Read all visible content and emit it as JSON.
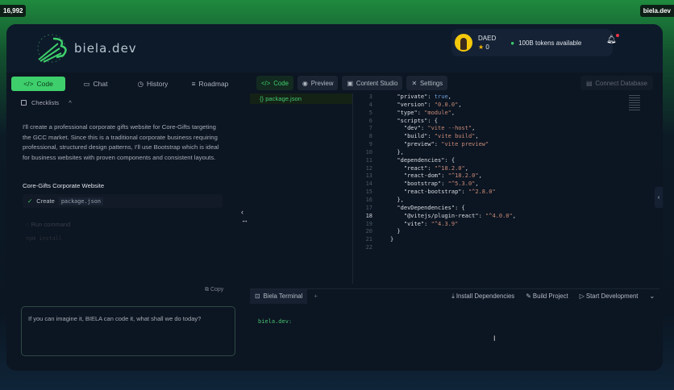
{
  "counter": "16,992",
  "badge": "biela.dev",
  "brand": {
    "name": "biela.dev",
    "accent": "#3ecf6c"
  },
  "user": {
    "name": "DAED",
    "stars": "0",
    "tokens": "100B tokens available"
  },
  "left": {
    "tabs": [
      {
        "label": "Code",
        "icon": "code-icon"
      },
      {
        "label": "Chat",
        "icon": "chat-icon"
      },
      {
        "label": "History",
        "icon": "clock-icon"
      },
      {
        "label": "Roadmap",
        "icon": "list-icon"
      }
    ],
    "checklists": "Checklists",
    "message": "I'll create a professional corporate gifts website for Core-Gifts targeting the GCC market. Since this is a traditional corporate business requiring professional, structured design patterns, I'll use Bootstrap which is ideal for business websites with proven components and consistent layouts.",
    "artifact_title": "Core-Gifts Corporate Website",
    "action_label": "Create",
    "action_file": "package.json",
    "faded_action": "Run command",
    "faded_cmd": "npm install",
    "copy": "Copy",
    "input_placeholder": "If you can imagine it, BIELA can code it, what shall we do today?"
  },
  "right": {
    "tabs": [
      {
        "label": "Code"
      },
      {
        "label": "Preview"
      },
      {
        "label": "Content Studio"
      },
      {
        "label": "Settings"
      }
    ],
    "connect_db": "Connect Database",
    "file": "package.json",
    "current_line": 18,
    "code": [
      {
        "n": "3",
        "t": [
          [
            "k",
            "  \"private\""
          ],
          [
            "k",
            ": "
          ],
          [
            "b",
            "true"
          ],
          [
            "k",
            ","
          ]
        ]
      },
      {
        "n": "4",
        "t": [
          [
            "k",
            "  \"version\""
          ],
          [
            "k",
            ": "
          ],
          [
            "s",
            "\"0.0.0\""
          ],
          [
            "k",
            ","
          ]
        ]
      },
      {
        "n": "5",
        "t": [
          [
            "k",
            "  \"type\""
          ],
          [
            "k",
            ": "
          ],
          [
            "s",
            "\"module\""
          ],
          [
            "k",
            ","
          ]
        ]
      },
      {
        "n": "6",
        "t": [
          [
            "k",
            "  \"scripts\": {"
          ]
        ]
      },
      {
        "n": "7",
        "t": [
          [
            "k",
            "    \"dev\""
          ],
          [
            "k",
            ": "
          ],
          [
            "s",
            "\"vite --host\""
          ],
          [
            "k",
            ","
          ]
        ]
      },
      {
        "n": "8",
        "t": [
          [
            "k",
            "    \"build\""
          ],
          [
            "k",
            ": "
          ],
          [
            "s",
            "\"vite build\""
          ],
          [
            "k",
            ","
          ]
        ]
      },
      {
        "n": "9",
        "t": [
          [
            "k",
            "    \"preview\""
          ],
          [
            "k",
            ": "
          ],
          [
            "s",
            "\"vite preview\""
          ]
        ]
      },
      {
        "n": "10",
        "t": [
          [
            "k",
            "  },"
          ]
        ]
      },
      {
        "n": "11",
        "t": [
          [
            "k",
            "  \"dependencies\": {"
          ]
        ]
      },
      {
        "n": "12",
        "t": [
          [
            "k",
            "    \"react\""
          ],
          [
            "k",
            ": "
          ],
          [
            "s",
            "\"^18.2.0\""
          ],
          [
            "k",
            ","
          ]
        ]
      },
      {
        "n": "13",
        "t": [
          [
            "k",
            "    \"react-dom\""
          ],
          [
            "k",
            ": "
          ],
          [
            "s",
            "\"^18.2.0\""
          ],
          [
            "k",
            ","
          ]
        ]
      },
      {
        "n": "14",
        "t": [
          [
            "k",
            "    \"bootstrap\""
          ],
          [
            "k",
            ": "
          ],
          [
            "s",
            "\"^5.3.0\""
          ],
          [
            "k",
            ","
          ]
        ]
      },
      {
        "n": "15",
        "t": [
          [
            "k",
            "    \"react-bootstrap\""
          ],
          [
            "k",
            ": "
          ],
          [
            "s",
            "\"^2.8.0\""
          ]
        ]
      },
      {
        "n": "16",
        "t": [
          [
            "k",
            "  },"
          ]
        ]
      },
      {
        "n": "17",
        "t": [
          [
            "k",
            "  \"devDependencies\": {"
          ]
        ]
      },
      {
        "n": "18",
        "t": [
          [
            "k",
            "    \"@vitejs/plugin-react\""
          ],
          [
            "k",
            ": "
          ],
          [
            "s",
            "\"^4.0.0\""
          ],
          [
            "k",
            ","
          ]
        ]
      },
      {
        "n": "19",
        "t": [
          [
            "k",
            "    \"vite\""
          ],
          [
            "k",
            ": "
          ],
          [
            "s",
            "\"^4.3.9\""
          ]
        ]
      },
      {
        "n": "20",
        "t": [
          [
            "k",
            "  }"
          ]
        ]
      },
      {
        "n": "21",
        "t": [
          [
            "k",
            "}"
          ]
        ]
      },
      {
        "n": "22",
        "t": []
      }
    ],
    "terminal": {
      "tab": "Biela Terminal",
      "add": "+",
      "actions": [
        "Install Dependencies",
        "Build Project",
        "Start Development"
      ],
      "prompt": "biela.dev:"
    }
  }
}
